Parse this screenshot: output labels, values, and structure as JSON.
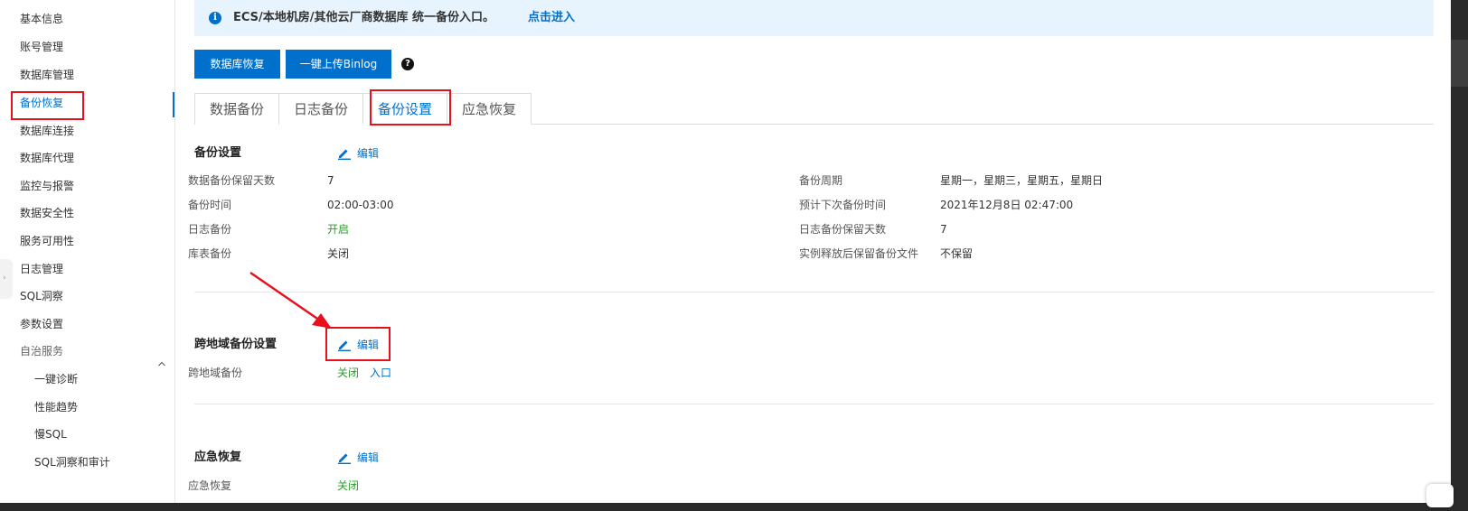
{
  "sidebar": {
    "items": [
      {
        "label": "基本信息"
      },
      {
        "label": "账号管理"
      },
      {
        "label": "数据库管理"
      },
      {
        "label": "备份恢复",
        "active": true
      },
      {
        "label": "数据库连接"
      },
      {
        "label": "数据库代理"
      },
      {
        "label": "监控与报警"
      },
      {
        "label": "数据安全性"
      },
      {
        "label": "服务可用性"
      },
      {
        "label": "日志管理"
      },
      {
        "label": "SQL洞察"
      },
      {
        "label": "参数设置"
      },
      {
        "label": "自治服务",
        "expanded": true
      }
    ],
    "subitems": [
      {
        "label": "一键诊断"
      },
      {
        "label": "性能趋势"
      },
      {
        "label": "慢SQL"
      },
      {
        "label": "SQL洞察和审计"
      }
    ]
  },
  "notice": {
    "icon": "info-icon",
    "text": "ECS/本地机房/其他云厂商数据库 统一备份入口。",
    "link": "点击进入"
  },
  "toolbar": {
    "restore_label": "数据库恢复",
    "upload_label": "一键上传Binlog",
    "help_icon": "question-circle-icon"
  },
  "tabs": [
    {
      "label": "数据备份"
    },
    {
      "label": "日志备份"
    },
    {
      "label": "备份设置",
      "active": true
    },
    {
      "label": "应急恢复"
    }
  ],
  "backup_settings": {
    "title": "备份设置",
    "edit_label": "编辑",
    "left": [
      {
        "label": "数据备份保留天数",
        "value": "7"
      },
      {
        "label": "备份时间",
        "value": "02:00-03:00"
      },
      {
        "label": "日志备份",
        "value": "开启"
      },
      {
        "label": "库表备份",
        "value": "关闭"
      }
    ],
    "right": [
      {
        "label": "备份周期",
        "value": "星期一，星期三，星期五，星期日"
      },
      {
        "label": "预计下次备份时间",
        "value": "2021年12月8日 02:47:00"
      },
      {
        "label": "日志备份保留天数",
        "value": "7"
      },
      {
        "label": "实例释放后保留备份文件",
        "value": "不保留"
      }
    ]
  },
  "cross_region": {
    "title": "跨地域备份设置",
    "edit_label": "编辑",
    "label": "跨地域备份",
    "value": "关闭",
    "link": "入口"
  },
  "emergency": {
    "title": "应急恢复",
    "edit_label": "编辑",
    "label": "应急恢复",
    "value": "关闭"
  },
  "colors": {
    "primary": "#0070cc",
    "highlight": "#e8101c",
    "success": "#2e9d2e",
    "notice_bg": "#e8f4fd"
  }
}
